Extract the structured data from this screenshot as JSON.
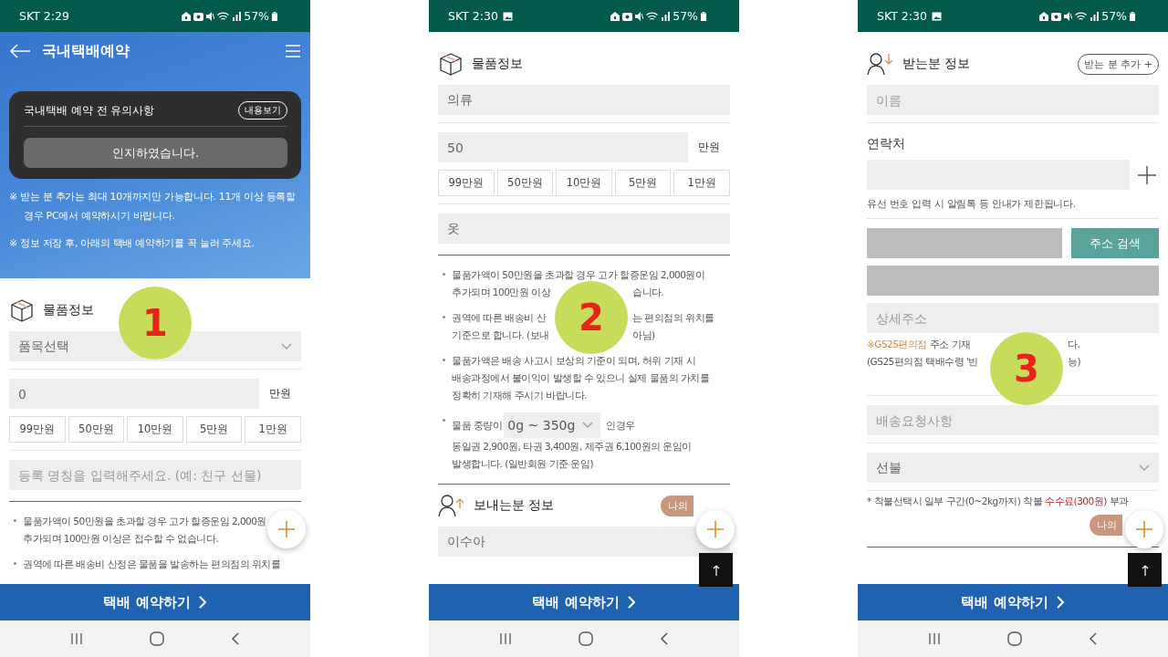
{
  "phones": [
    {
      "status": {
        "time": "SKT 2:29",
        "battery": "57%"
      },
      "marker": "1",
      "plus_button": true,
      "header": {
        "title": "국내택배예약",
        "notice_title": "국내택배 예약 전 유의사항",
        "notice_action": "내용보기",
        "confirm": "인지하였습니다.",
        "notes": [
          "※ 받는 분 추가는 최대 10개까지만 가능합니다. 11개 이상 등록할 경우 PC에서 예약하시기 바랍니다.",
          "※ 정보 저장 후, 아래의 택배 예약하기를 꼭 눌러 주세요."
        ]
      },
      "blocks": [
        {
          "kind": "goods",
          "title": "물품정보"
        },
        {
          "kind": "select",
          "value": "품목선택"
        },
        {
          "kind": "divider"
        },
        {
          "kind": "amount",
          "value": "0",
          "unit": "만원"
        },
        {
          "kind": "chips",
          "items": [
            "99만원",
            "50만원",
            "10만원",
            "5만원",
            "1만원"
          ]
        },
        {
          "kind": "divider"
        },
        {
          "kind": "field",
          "placeholder": "등록 명칭을 입력해주세요. (예: 친구 선물)"
        },
        {
          "kind": "rule"
        },
        {
          "kind": "notes",
          "items": [
            {
              "lines": [
                {
                  "parts": [
                    {
                      "text": "물품가액이 50만원을 초과할 경우 고가 할증운임 2,000원"
                    }
                  ]
                },
                {
                  "parts": [
                    {
                      "text": "추가되며 100만원 이상은 접수할 수 없습니다."
                    }
                  ]
                }
              ]
            },
            {
              "lines": [
                {
                  "parts": [
                    {
                      "text": "권역에 따른 배송비 산정은 물품을 발송하는 편의점의 위치를"
                    }
                  ]
                }
              ]
            }
          ]
        }
      ],
      "cta": "택배 예약하기"
    },
    {
      "status": {
        "time": "SKT 2:30",
        "gallery": true,
        "battery": "57%"
      },
      "marker": "2",
      "plus_button": true,
      "top_button": true,
      "blocks": [
        {
          "kind": "goods",
          "title": "물품정보"
        },
        {
          "kind": "field",
          "value": "의류"
        },
        {
          "kind": "divider"
        },
        {
          "kind": "amount",
          "value": "50",
          "unit": "만원"
        },
        {
          "kind": "chips",
          "items": [
            "99만원",
            "50만원",
            "10만원",
            "5만원",
            "1만원"
          ]
        },
        {
          "kind": "divider"
        },
        {
          "kind": "field",
          "value": "옷"
        },
        {
          "kind": "rule"
        },
        {
          "kind": "notes",
          "items": [
            {
              "lines": [
                {
                  "parts": [
                    {
                      "text": "물품가액이 50만원을 초과할 경우 고가 할증운임 2,000원이"
                    }
                  ]
                },
                {
                  "parts": [
                    {
                      "text": "추가되며 100만원 이상"
                    }
                  ],
                  "after_cover": [
                    {
                      "text": "습니다."
                    }
                  ]
                }
              ]
            },
            {
              "lines": [
                {
                  "parts": [
                    {
                      "text": "권역에 따른 배송비 산"
                    }
                  ],
                  "after_cover": [
                    {
                      "text": "는 편의점의 위치를"
                    }
                  ]
                },
                {
                  "parts": [
                    {
                      "text": "기준으로 합니다. (보내"
                    }
                  ],
                  "after_cover": [
                    {
                      "text": "아님)"
                    }
                  ]
                }
              ]
            },
            {
              "lines": [
                {
                  "parts": [
                    {
                      "text": "물품가액은 배송 사고시 보상의 기준이 되며, 허위 기재 시"
                    }
                  ]
                },
                {
                  "parts": [
                    {
                      "text": "배송과정에서 불이익이 발생할 수 있으니 실제 물품의 가치를"
                    }
                  ]
                },
                {
                  "parts": [
                    {
                      "text": "정확히 기재해 주시기 바랍니다."
                    }
                  ]
                }
              ]
            },
            {
              "lines": [
                {
                  "parts": [
                    {
                      "text": "물품 중량이"
                    },
                    {
                      "text": "0g ~ 350g",
                      "kind": "select"
                    },
                    {
                      "text": "인경우"
                    }
                  ]
                },
                {
                  "parts": [
                    {
                      "text": "동일권 2,900원, 타권 3,400원, 제주권 6,100원의 운임이"
                    }
                  ]
                },
                {
                  "parts": [
                    {
                      "text": "발생합니다. (일반회원 기준 운임)"
                    }
                  ]
                }
              ]
            }
          ]
        },
        {
          "kind": "rule"
        },
        {
          "kind": "sender",
          "title": "보내는분 정보",
          "badge": "나의"
        },
        {
          "kind": "field",
          "value": "이수아"
        }
      ],
      "cta": "택배 예약하기"
    },
    {
      "status": {
        "time": "SKT 2:30",
        "gallery": true,
        "battery": "57%"
      },
      "marker": "3",
      "plus_button": true,
      "top_button": true,
      "blocks": [
        {
          "kind": "receiver",
          "title": "받는분 정보",
          "action": "받는 분 추가 +"
        },
        {
          "kind": "field",
          "placeholder": "이름"
        },
        {
          "kind": "divider"
        },
        {
          "kind": "label",
          "text": "연락처"
        },
        {
          "kind": "contact"
        },
        {
          "kind": "hint",
          "text": "유선 번호 입력 시 알림톡 등 안내가 제한됩니다."
        },
        {
          "kind": "divider"
        },
        {
          "kind": "address",
          "disabled": true,
          "button": "주소 검색"
        },
        {
          "kind": "field",
          "disabled": true
        },
        {
          "kind": "field",
          "placeholder": "상세주소"
        },
        {
          "kind": "notice",
          "lines": [
            {
              "parts": [
                {
                  "text": "※GS25편의점",
                  "color": "#e2873c"
                },
                {
                  "text": " 주소 기재"
                }
              ],
              "after_cover": [
                {
                  "text": "다."
                }
              ]
            },
            {
              "parts": [
                {
                  "text": "(GS25편의점 택배수령 '빈"
                }
              ],
              "after_cover": [
                {
                  "text": "능)"
                }
              ]
            }
          ]
        },
        {
          "kind": "divider"
        },
        {
          "kind": "field",
          "placeholder": "배송요청사항"
        },
        {
          "kind": "divider"
        },
        {
          "kind": "select",
          "value": "선불"
        },
        {
          "kind": "divider"
        },
        {
          "kind": "notice",
          "lines": [
            {
              "parts": [
                {
                  "text": "* 착불선택시 일부 구간(0~2kg까지) 착불 "
                },
                {
                  "text": "수수료(300원)",
                  "color": "#c41e1e"
                },
                {
                  "text": " 부과"
                }
              ]
            }
          ]
        },
        {
          "kind": "badge",
          "text": "나의"
        },
        {
          "kind": "rule"
        }
      ],
      "cta": "택배 예약하기"
    }
  ]
}
